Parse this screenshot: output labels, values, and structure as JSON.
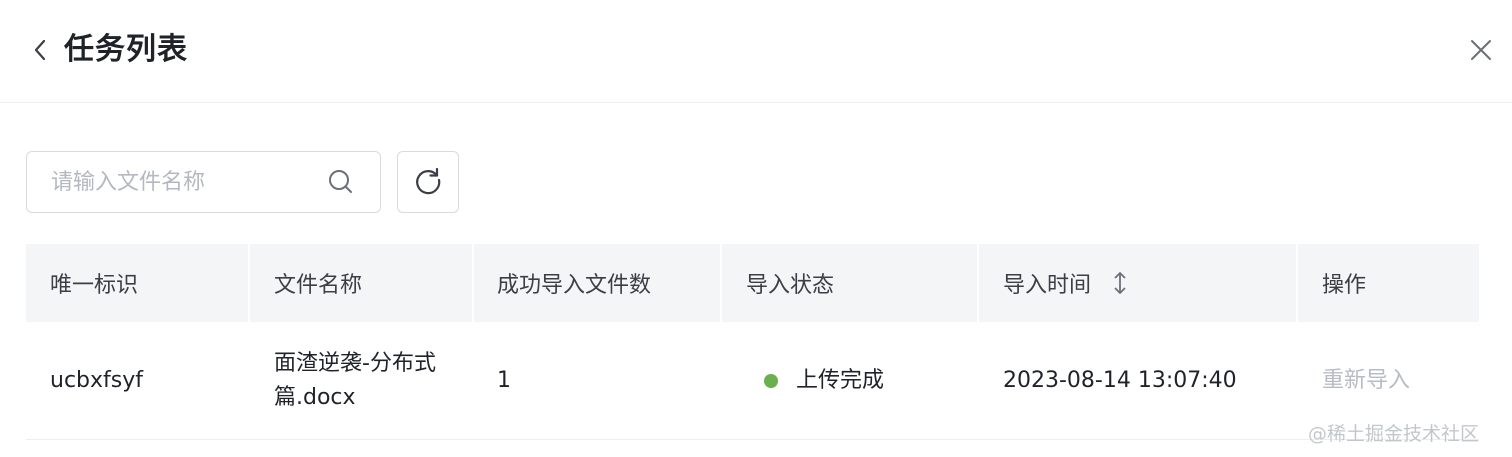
{
  "header": {
    "title": "任务列表"
  },
  "search": {
    "placeholder": "请输入文件名称",
    "value": ""
  },
  "table": {
    "columns": {
      "id": "唯一标识",
      "file_name": "文件名称",
      "success_count": "成功导入文件数",
      "status": "导入状态",
      "time": "导入时间",
      "action": "操作"
    },
    "rows": [
      {
        "id": "ucbxfsyf",
        "file_name_line1": "面渣逆袭-分布式",
        "file_name_line2": "篇.docx",
        "success_count": "1",
        "status": "上传完成",
        "status_color": "#6ab04c",
        "time": "2023-08-14 13:07:40",
        "action": "重新导入"
      }
    ]
  },
  "watermark": "@稀土掘金技术社区",
  "icons": {
    "back": "chevron-left-icon",
    "close": "close-icon",
    "search": "search-icon",
    "refresh": "refresh-icon",
    "sort": "sort-icon"
  }
}
